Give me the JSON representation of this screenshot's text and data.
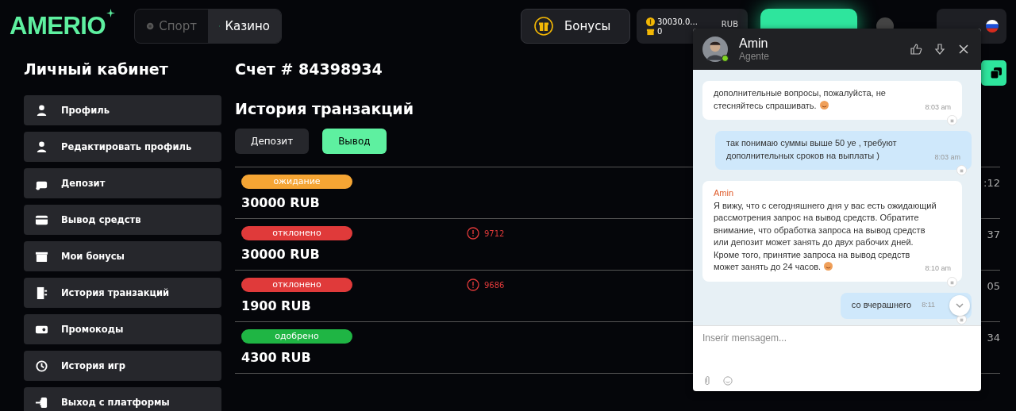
{
  "header": {
    "logo": "AMERIO",
    "modes": [
      {
        "label": "Спорт",
        "selected": false
      },
      {
        "label": "Казино",
        "selected": true
      }
    ],
    "bonuses_button": "Бонусы",
    "balance": {
      "amount": "30030.0...",
      "bonus": "0",
      "currency": "RUB"
    }
  },
  "sidebar": {
    "title": "Личный кабинет",
    "items": [
      {
        "label": "Профиль"
      },
      {
        "label": "Редактировать профиль"
      },
      {
        "label": "Депозит"
      },
      {
        "label": "Вывод средств"
      },
      {
        "label": "Мои бонусы"
      },
      {
        "label": "История транзакций"
      },
      {
        "label": "Промокоды"
      },
      {
        "label": "История игр"
      },
      {
        "label": "Выход с платформы"
      }
    ]
  },
  "account_title": "Счет # 84398934",
  "history": {
    "title": "История транзакций",
    "tabs": [
      {
        "label": "Депозит",
        "selected": false
      },
      {
        "label": "Вывод",
        "selected": true
      }
    ],
    "rows": [
      {
        "status": "ожидание",
        "color": "#f5a534",
        "amount": "30000 RUB",
        "time": ":12"
      },
      {
        "status": "отклонено",
        "color": "#e03a3a",
        "amount": "30000 RUB",
        "code": "9712",
        "time": "37"
      },
      {
        "status": "отклонено",
        "color": "#e03a3a",
        "amount": "1900 RUB",
        "code": "9686",
        "time": "05"
      },
      {
        "status": "одобрено",
        "color": "#1fb544",
        "amount": "4300 RUB",
        "time": "34"
      }
    ]
  },
  "chat": {
    "agent_name": "Amin",
    "agent_role": "Agente",
    "online": true,
    "messages": [
      {
        "kind": "agent",
        "lines": [
          "дополнительные вопросы, пожалуйста, не",
          "стесняйтесь спрашивать."
        ],
        "emoji": true,
        "time": "8:03 am"
      },
      {
        "kind": "user",
        "lines": [
          "так понимаю суммы выше 50 уе , требуют",
          "дополнительных сроков на выплаты )"
        ],
        "time": "8:03 am"
      },
      {
        "kind": "agent",
        "sender": "Amin",
        "lines": [
          "Я вижу, что с сегодняшнего дня у вас есть ожидающий",
          "рассмотрения запрос на вывод средств. Обратите",
          "внимание, что обработка запроса на вывод средств",
          "или депозит может занять до двух рабочих дней.",
          "Кроме того, принятие запроса на вывод средств",
          "может занять до 24 часов."
        ],
        "emoji": true,
        "time": "8:10 am"
      },
      {
        "kind": "user",
        "lines": [
          "со вчерашнего"
        ],
        "time": "8:11"
      }
    ],
    "input": {
      "placeholder": "Inserir mensagem..."
    }
  }
}
